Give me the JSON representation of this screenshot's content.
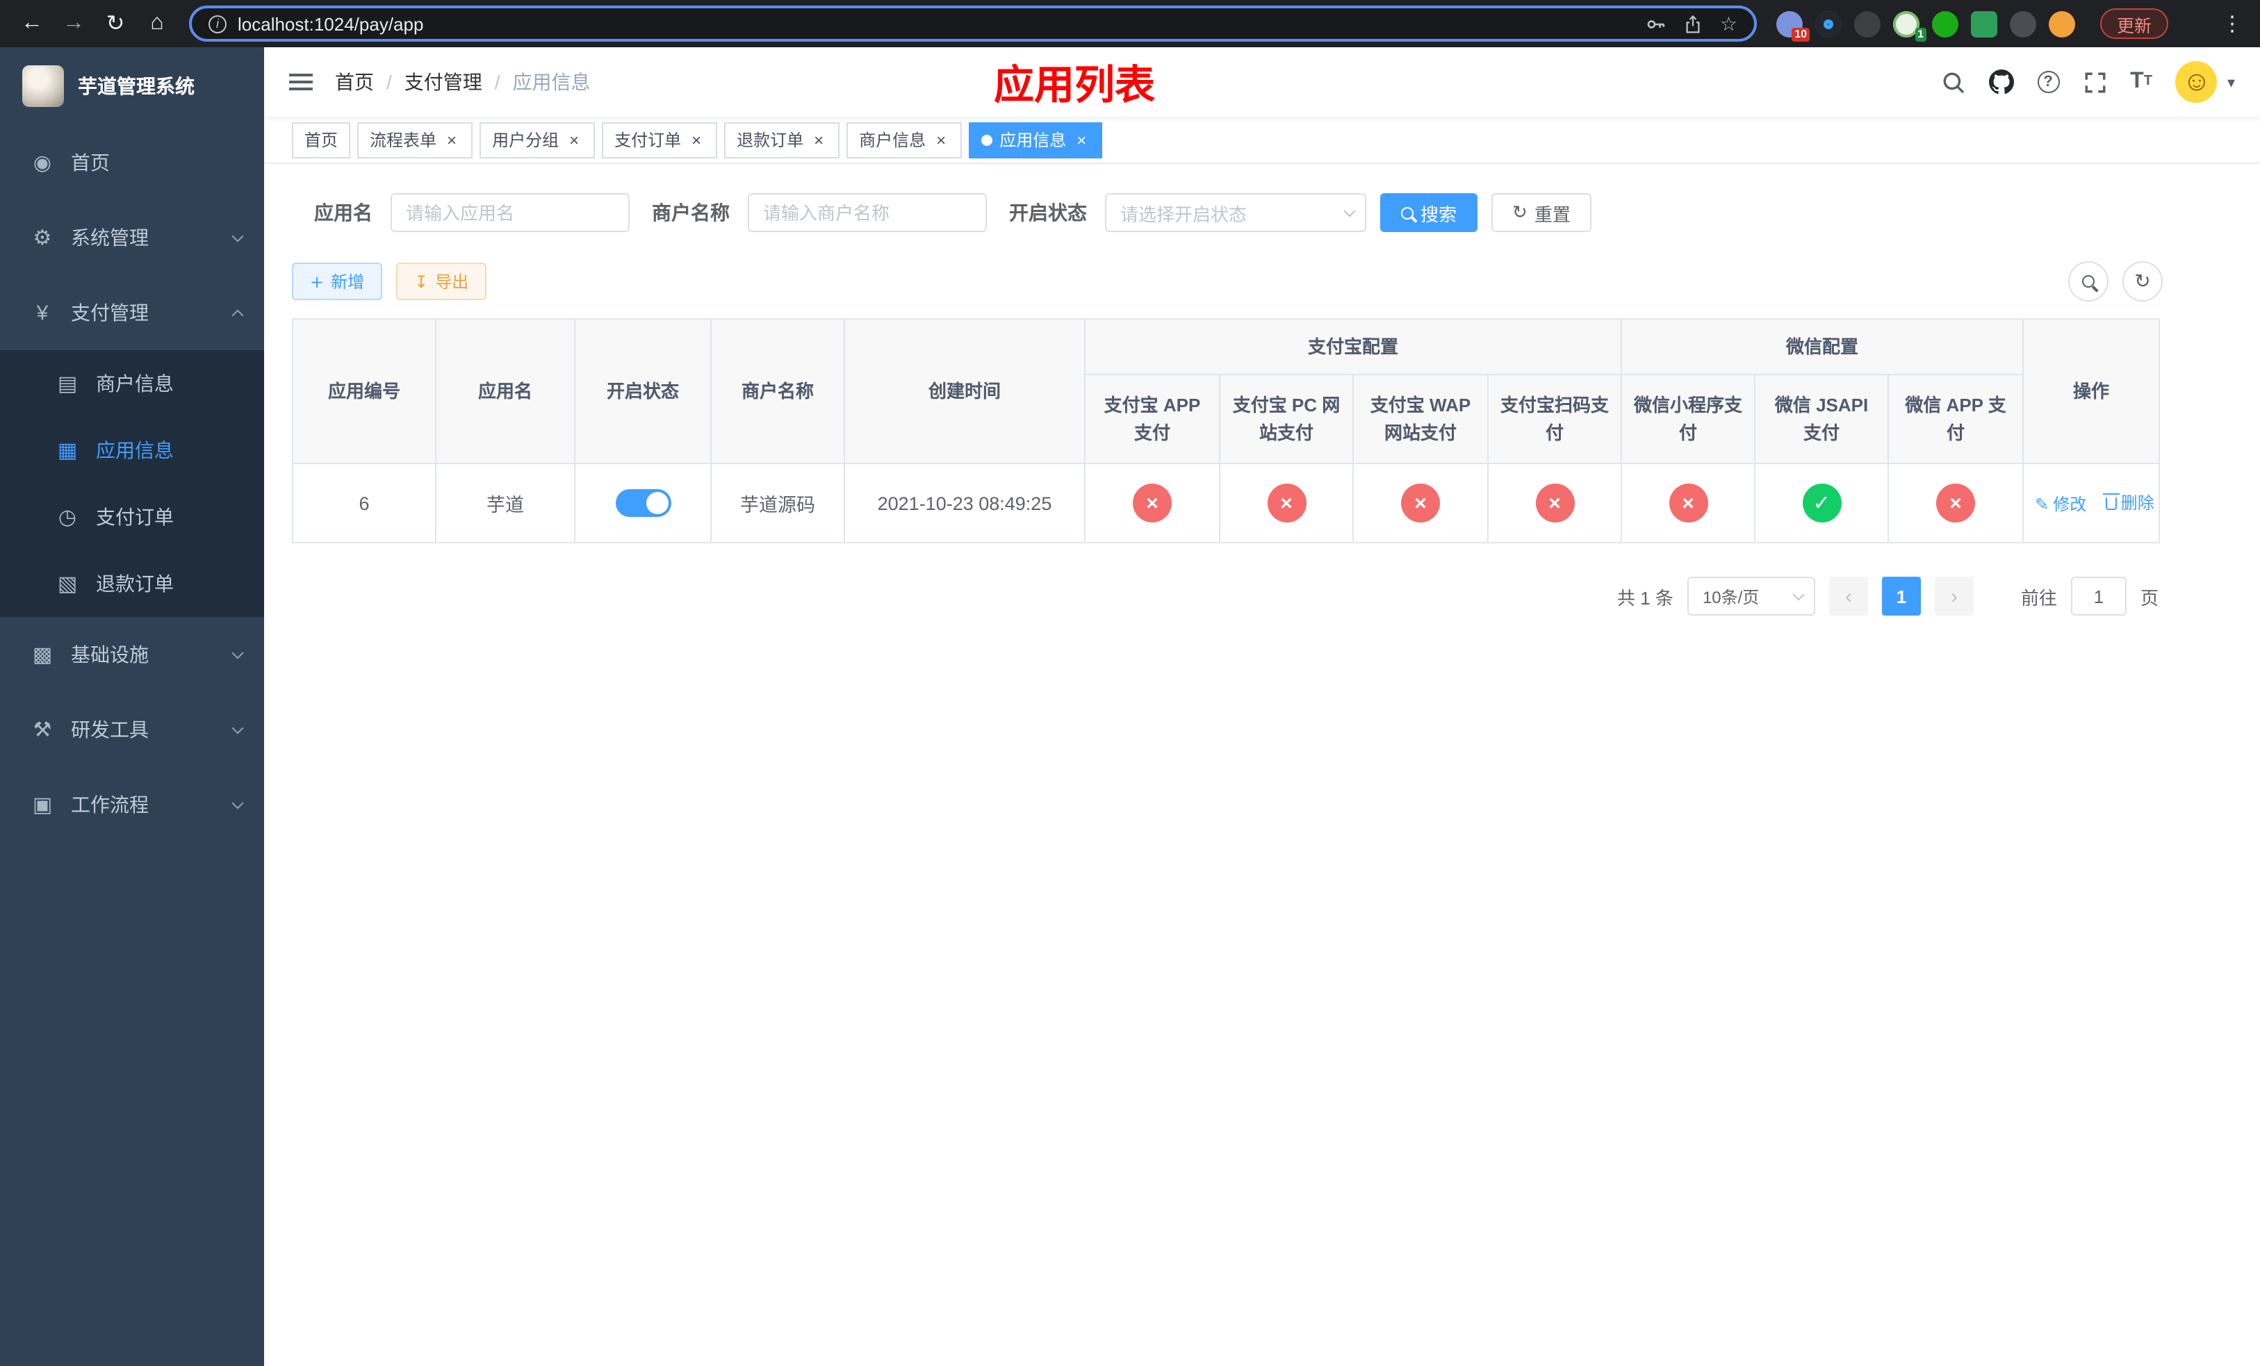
{
  "colors": {
    "primary": "#409eff",
    "success": "#13ce66",
    "danger": "#f56c6c",
    "warning": "#e6a23c",
    "title_red": "#ff0000"
  },
  "icons": {
    "back": "←",
    "forward": "→",
    "reload": "↻",
    "home": "⌂",
    "info": "i",
    "star": "☆",
    "menu_dots": "⋮",
    "dashboard": "◉",
    "system": "⚙",
    "payment": "¥",
    "merchant": "▤",
    "app": "▦",
    "pay_order": "◷",
    "refund_order": "▧",
    "infra": "▩",
    "devtools": "⚒",
    "workflow": "▣",
    "help": "?",
    "font_size": "T",
    "smile": "☺",
    "caret_down": "▾",
    "plus": "+",
    "download": "↧",
    "refresh": "↻",
    "edit": "✎",
    "check": "✓",
    "cross": "×",
    "close": "×",
    "prev": "‹",
    "next": "›",
    "sep": "/"
  },
  "browser": {
    "url": "localhost:1024/pay/app",
    "update_button": "更新",
    "extension_badge_1": "10",
    "extension_badge_2": "1"
  },
  "sidebar": {
    "app_title": "芋道管理系统",
    "menu": [
      {
        "label": "首页"
      },
      {
        "label": "系统管理"
      },
      {
        "label": "支付管理"
      },
      {
        "label": "基础设施"
      },
      {
        "label": "研发工具"
      },
      {
        "label": "工作流程"
      }
    ],
    "payment_submenu": [
      {
        "label": "商户信息"
      },
      {
        "label": "应用信息",
        "active": true
      },
      {
        "label": "支付订单"
      },
      {
        "label": "退款订单"
      }
    ]
  },
  "header": {
    "breadcrumb": [
      "首页",
      "支付管理",
      "应用信息"
    ],
    "page_title": "应用列表"
  },
  "tabs": [
    {
      "label": "首页",
      "closable": false,
      "active": false
    },
    {
      "label": "流程表单",
      "closable": true,
      "active": false
    },
    {
      "label": "用户分组",
      "closable": true,
      "active": false
    },
    {
      "label": "支付订单",
      "closable": true,
      "active": false
    },
    {
      "label": "退款订单",
      "closable": true,
      "active": false
    },
    {
      "label": "商户信息",
      "closable": true,
      "active": false
    },
    {
      "label": "应用信息",
      "closable": true,
      "active": true
    }
  ],
  "filters": {
    "app_name_label": "应用名",
    "app_name_placeholder": "请输入应用名",
    "merchant_label": "商户名称",
    "merchant_placeholder": "请输入商户名称",
    "status_label": "开启状态",
    "status_placeholder": "请选择开启状态",
    "search_button": "搜索",
    "reset_button": "重置"
  },
  "toolbar": {
    "add_button": "新增",
    "export_button": "导出"
  },
  "table": {
    "columns": [
      "应用编号",
      "应用名",
      "开启状态",
      "商户名称",
      "创建时间"
    ],
    "alipay_group": "支付宝配置",
    "wechat_group": "微信配置",
    "alipay_columns": [
      "支付宝 APP 支付",
      "支付宝 PC 网站支付",
      "支付宝 WAP 网站支付",
      "支付宝扫码支付"
    ],
    "wechat_columns": [
      "微信小程序支付",
      "微信 JSAPI 支付",
      "微信 APP 支付"
    ],
    "actions_column": "操作",
    "rows": [
      {
        "app_id": "6",
        "app_name": "芋道",
        "status_on": true,
        "merchant_name": "芋道源码",
        "create_time": "2021-10-23 08:49:25",
        "configs": [
          "no",
          "no",
          "no",
          "no",
          "no",
          "yes",
          "no"
        ],
        "edit_label": "修改",
        "delete_label": "删除"
      }
    ]
  },
  "pagination": {
    "total_text": "共 1 条",
    "page_size_text": "10条/页",
    "current_page": "1",
    "goto_prefix": "前往",
    "goto_value": "1",
    "goto_suffix": "页"
  }
}
